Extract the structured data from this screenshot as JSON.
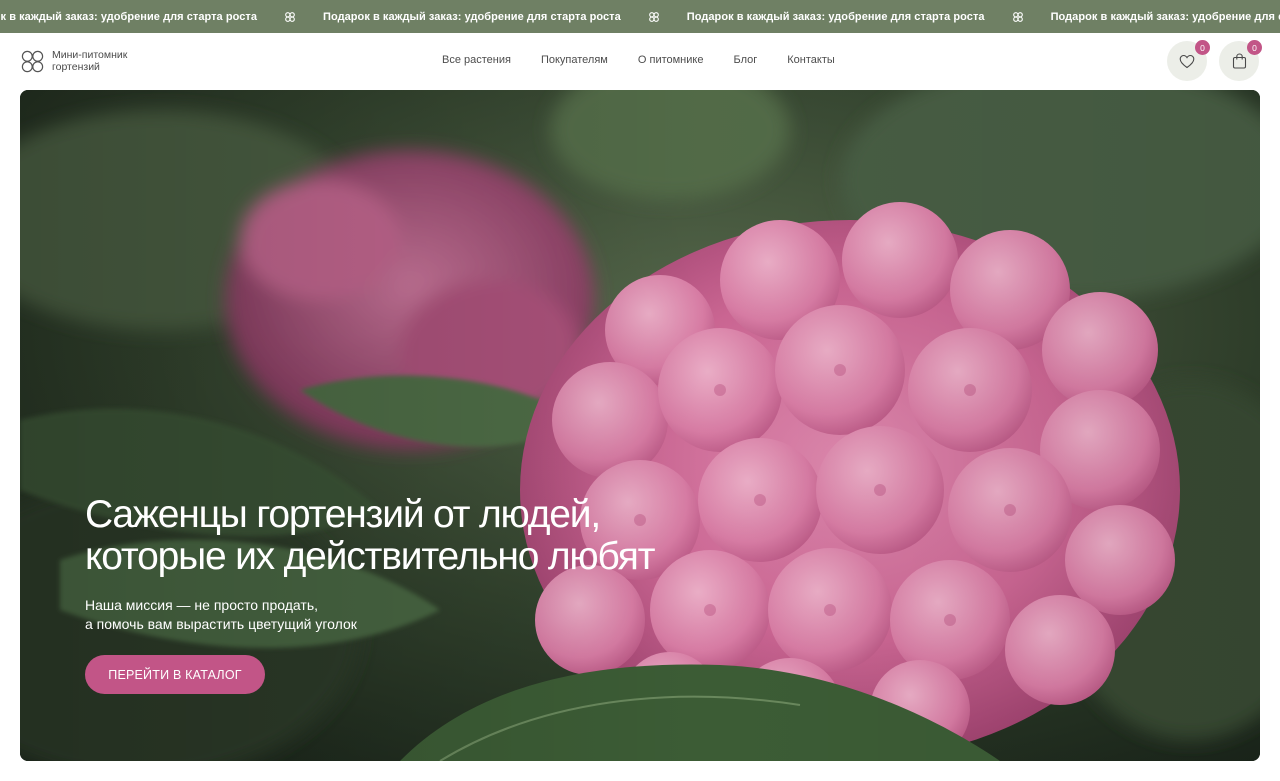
{
  "ticker": {
    "items": [
      "рок в каждый заказ: удобрение для старта роста",
      "Подарок в каждый заказ: удобрение для старта роста",
      "Подарок в каждый заказ: удобрение для старта роста",
      "Подарок в каждый заказ: удобрение для старта роста"
    ],
    "separator_icon": "flower-icon"
  },
  "header": {
    "logo_text": "Мини-питомник гортензий",
    "logo_icon": "flower-icon",
    "nav": [
      "Все растения",
      "Покупателям",
      "О питомнике",
      "Блог",
      "Контакты"
    ],
    "favorites": {
      "icon": "heart-icon",
      "count": "0"
    },
    "cart": {
      "icon": "bag-icon",
      "count": "0"
    }
  },
  "hero": {
    "title_line1": "Саженцы гортензий от людей,",
    "title_line2": "которые их действительно любят",
    "subtitle_line1": "Наша миссия — не просто продать,",
    "subtitle_line2": "а помочь вам вырастить цветущий уголок",
    "cta": "ПЕРЕЙТИ В КАТАЛОГ",
    "photo": "pink hydrangea photo"
  },
  "colors": {
    "ticker_bg": "#6f8064",
    "accent": "#c25587",
    "icon_button_bg": "#eceee8"
  }
}
